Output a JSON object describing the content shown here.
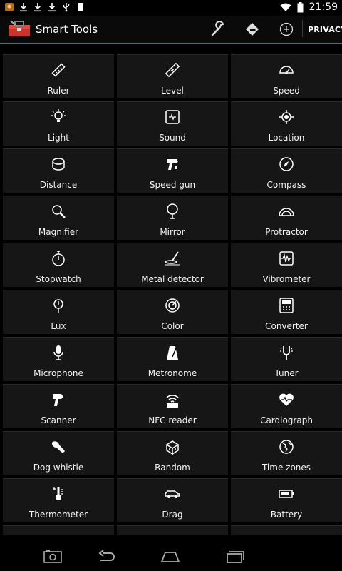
{
  "status_bar": {
    "time": "21:59",
    "notification_icons": [
      "pin-notification-icon",
      "download-icon",
      "download-icon",
      "download-icon",
      "usb-icon",
      "sd-card-icon"
    ],
    "wifi_icon": "wifi-icon",
    "battery_icon": "battery-icon"
  },
  "action_bar": {
    "title": "Smart Tools",
    "app_icon": "toolbox-icon",
    "actions": [
      "wrench-icon",
      "directions-icon",
      "add-circle-icon"
    ],
    "privacy_label": "PRIVACY"
  },
  "tools": [
    {
      "label": "Ruler",
      "icon": "ruler-icon"
    },
    {
      "label": "Level",
      "icon": "level-icon"
    },
    {
      "label": "Speed",
      "icon": "speedometer-icon"
    },
    {
      "label": "Light",
      "icon": "light-bulb-icon"
    },
    {
      "label": "Sound",
      "icon": "sound-meter-icon"
    },
    {
      "label": "Location",
      "icon": "location-icon"
    },
    {
      "label": "Distance",
      "icon": "distance-icon"
    },
    {
      "label": "Speed gun",
      "icon": "speed-gun-icon"
    },
    {
      "label": "Compass",
      "icon": "compass-icon"
    },
    {
      "label": "Magnifier",
      "icon": "magnifier-icon"
    },
    {
      "label": "Mirror",
      "icon": "mirror-icon"
    },
    {
      "label": "Protractor",
      "icon": "protractor-icon"
    },
    {
      "label": "Stopwatch",
      "icon": "stopwatch-icon"
    },
    {
      "label": "Metal detector",
      "icon": "metal-detector-icon"
    },
    {
      "label": "Vibrometer",
      "icon": "vibrometer-icon"
    },
    {
      "label": "Lux",
      "icon": "lux-icon"
    },
    {
      "label": "Color",
      "icon": "color-icon"
    },
    {
      "label": "Converter",
      "icon": "converter-icon"
    },
    {
      "label": "Microphone",
      "icon": "microphone-icon"
    },
    {
      "label": "Metronome",
      "icon": "metronome-icon"
    },
    {
      "label": "Tuner",
      "icon": "tuning-fork-icon"
    },
    {
      "label": "Scanner",
      "icon": "barcode-scanner-icon"
    },
    {
      "label": "NFC reader",
      "icon": "nfc-icon"
    },
    {
      "label": "Cardiograph",
      "icon": "heart-pulse-icon"
    },
    {
      "label": "Dog whistle",
      "icon": "dog-whistle-icon"
    },
    {
      "label": "Random",
      "icon": "dice-icon"
    },
    {
      "label": "Time zones",
      "icon": "globe-icon"
    },
    {
      "label": "Thermometer",
      "icon": "thermometer-icon"
    },
    {
      "label": "Drag",
      "icon": "car-icon"
    },
    {
      "label": "Battery",
      "icon": "battery-tool-icon"
    },
    {
      "label": "",
      "icon": ""
    },
    {
      "label": "",
      "icon": ""
    },
    {
      "label": "",
      "icon": ""
    }
  ],
  "nav_bar": {
    "buttons": [
      "screenshot-icon",
      "back-icon",
      "home-icon",
      "recent-apps-icon"
    ]
  },
  "colors": {
    "background": "#000000",
    "tile": "#161616",
    "accent_line": "#4c6e87",
    "text": "#ffffff"
  }
}
